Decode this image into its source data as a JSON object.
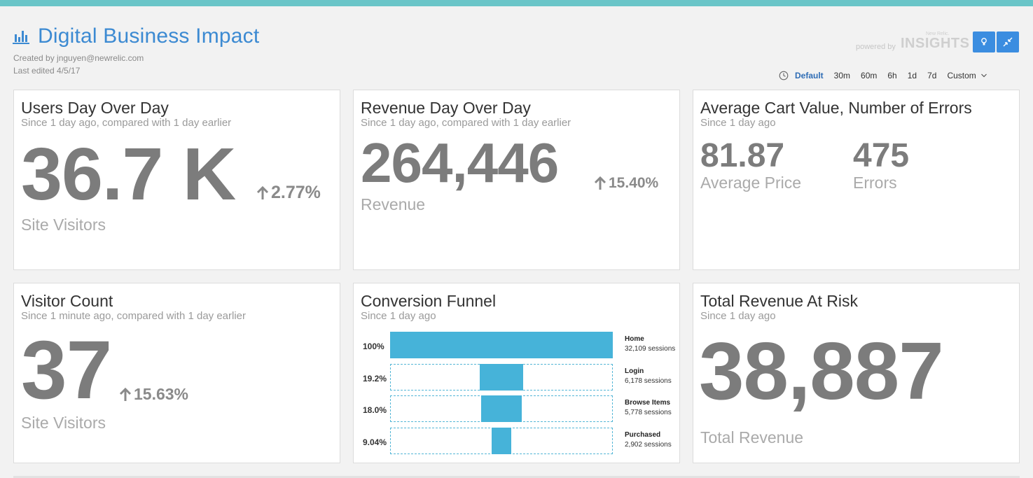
{
  "header": {
    "title": "Digital Business Impact",
    "created_by": "Created by jnguyen@newrelic.com",
    "last_edited": "Last edited 4/5/17",
    "brand_small": "powered by",
    "brand_tiny": "New Relic.",
    "brand_big": "INSIGHTS",
    "accent_color": "#3c8ad2",
    "bar_color": "#6ac5c8",
    "buttons": [
      {
        "icon": "lightbulb-icon"
      },
      {
        "icon": "fullscreen-collapse-icon"
      }
    ]
  },
  "time_range": {
    "icon": "clock-icon",
    "options": [
      "Default",
      "30m",
      "60m",
      "6h",
      "1d",
      "7d",
      "Custom"
    ],
    "selected": "Default"
  },
  "widgets": {
    "users": {
      "title": "Users Day Over Day",
      "subtitle": "Since 1 day ago, compared with 1 day earlier",
      "value": "36.7 K",
      "change": "2.77%",
      "label": "Site Visitors"
    },
    "revenue": {
      "title": "Revenue Day Over Day",
      "subtitle": "Since 1 day ago, compared with 1 day earlier",
      "value": "264,446",
      "change": "15.40%",
      "label": "Revenue"
    },
    "cart": {
      "title": "Average Cart Value, Number of Errors",
      "subtitle": "Since 1 day ago",
      "metrics": [
        {
          "value": "81.87",
          "label": "Average Price"
        },
        {
          "value": "475",
          "label": "Errors"
        }
      ]
    },
    "visitors": {
      "title": "Visitor Count",
      "subtitle": "Since 1 minute ago, compared with 1 day earlier",
      "value": "37",
      "change": "15.63%",
      "label": "Site Visitors"
    },
    "funnel": {
      "title": "Conversion Funnel",
      "subtitle": "Since 1 day ago",
      "bar_color": "#46b3d9",
      "steps": [
        {
          "pct": "100%",
          "fraction": 1.0,
          "name": "Home",
          "sessions": "32,109 sessions"
        },
        {
          "pct": "19.2%",
          "fraction": 0.192,
          "name": "Login",
          "sessions": "6,178 sessions"
        },
        {
          "pct": "18.0%",
          "fraction": 0.18,
          "name": "Browse Items",
          "sessions": "5,778 sessions"
        },
        {
          "pct": "9.04%",
          "fraction": 0.0904,
          "name": "Purchased",
          "sessions": "2,902 sessions"
        }
      ]
    },
    "risk": {
      "title": "Total Revenue At Risk",
      "subtitle": "Since 1 day ago",
      "value": "38,887",
      "label": "Total Revenue"
    }
  }
}
